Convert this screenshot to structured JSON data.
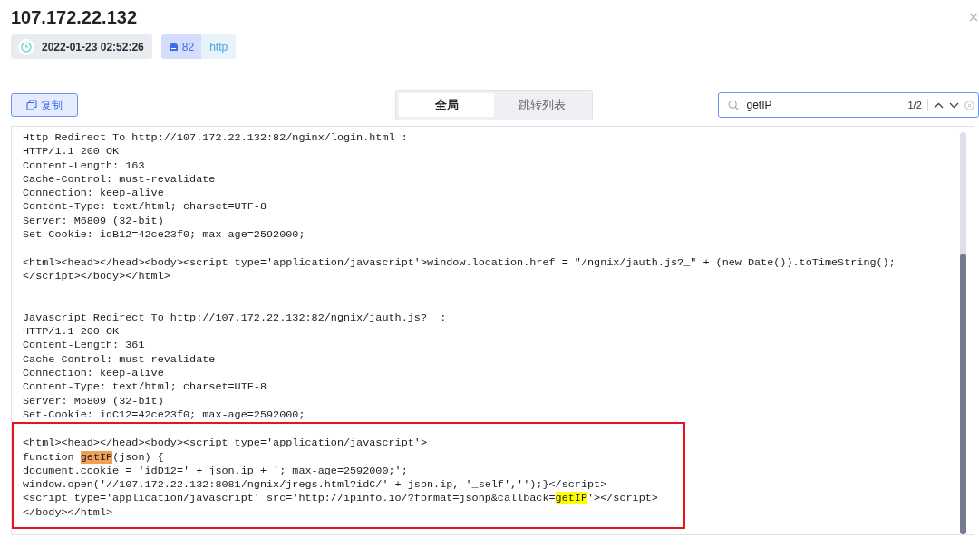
{
  "title": "107.172.22.132",
  "tags": [
    {
      "kind": "time",
      "text": "2022-01-23 02:52:26"
    },
    {
      "kind": "port",
      "text": "82"
    },
    {
      "kind": "protocol",
      "text": "http"
    }
  ],
  "copy_button": {
    "label": "复制"
  },
  "tabs": [
    {
      "label": "全局",
      "selected": true
    },
    {
      "label": "跳转列表",
      "selected": false
    }
  ],
  "search": {
    "value": "getIP",
    "count": "1/2"
  },
  "code_blocks": [
    {
      "outlined": false,
      "lines": [
        {
          "parts": [
            {
              "text": "Http Redirect To http://107.172.22.132:82/nginx/login.html :"
            }
          ]
        },
        {
          "parts": [
            {
              "text": "HTTP/1.1 200 OK"
            }
          ]
        },
        {
          "parts": [
            {
              "text": "Content-Length: 163"
            }
          ]
        },
        {
          "parts": [
            {
              "text": "Cache-Control: must-revalidate"
            }
          ]
        },
        {
          "parts": [
            {
              "text": "Connection: keep-alive"
            }
          ]
        },
        {
          "parts": [
            {
              "text": "Content-Type: text/html; charset=UTF-8"
            }
          ]
        },
        {
          "parts": [
            {
              "text": "Server: M6809 (32-bit)"
            }
          ]
        },
        {
          "parts": [
            {
              "text": "Set-Cookie: idB12=42ce23f0; max-age=2592000;"
            }
          ]
        },
        {
          "kind": "blank"
        },
        {
          "parts": [
            {
              "text": "<html><head></head><body><script type='application/javascript'>window.location.href = \"/ngnix/jauth.js?_\" + (new Date()).toTimeString();"
            }
          ]
        },
        {
          "parts": [
            {
              "text": "</script></body></html>"
            }
          ]
        },
        {
          "kind": "blank"
        },
        {
          "kind": "blank"
        },
        {
          "parts": [
            {
              "text": "Javascript Redirect To http://107.172.22.132:82/ngnix/jauth.js?_ :"
            }
          ]
        },
        {
          "parts": [
            {
              "text": "HTTP/1.1 200 OK"
            }
          ]
        },
        {
          "parts": [
            {
              "text": "Content-Length: 361"
            }
          ]
        },
        {
          "parts": [
            {
              "text": "Cache-Control: must-revalidate"
            }
          ]
        },
        {
          "parts": [
            {
              "text": "Connection: keep-alive"
            }
          ]
        },
        {
          "parts": [
            {
              "text": "Content-Type: text/html; charset=UTF-8"
            }
          ]
        },
        {
          "parts": [
            {
              "text": "Server: M6809 (32-bit)"
            }
          ]
        },
        {
          "parts": [
            {
              "text": "Set-Cookie: idC12=42ce23f0; max-age=2592000;"
            }
          ]
        }
      ]
    },
    {
      "outlined": true,
      "lines": [
        {
          "parts": [
            {
              "text": "<html><head></head><body><script type='application/javascript'>"
            }
          ]
        },
        {
          "parts": [
            {
              "text": "function "
            },
            {
              "text": "getIP",
              "highlighted": true,
              "current": true
            },
            {
              "text": "(json) {"
            }
          ]
        },
        {
          "parts": [
            {
              "text": "document.cookie = 'idD12=' + json.ip + '; max-age=2592000;';"
            }
          ]
        },
        {
          "parts": [
            {
              "text": "window.open('//107.172.22.132:8081/ngnix/jregs.html?idC/' + json.ip, '_self','');}</script>"
            }
          ]
        },
        {
          "parts": [
            {
              "text": "<script type='application/javascript' src='http://ipinfo.io/?format=jsonp&callback="
            },
            {
              "text": "getIP",
              "highlighted": true,
              "current": false
            },
            {
              "text": "'></script>"
            }
          ]
        },
        {
          "parts": [
            {
              "text": "</body></html>"
            }
          ]
        }
      ]
    }
  ]
}
